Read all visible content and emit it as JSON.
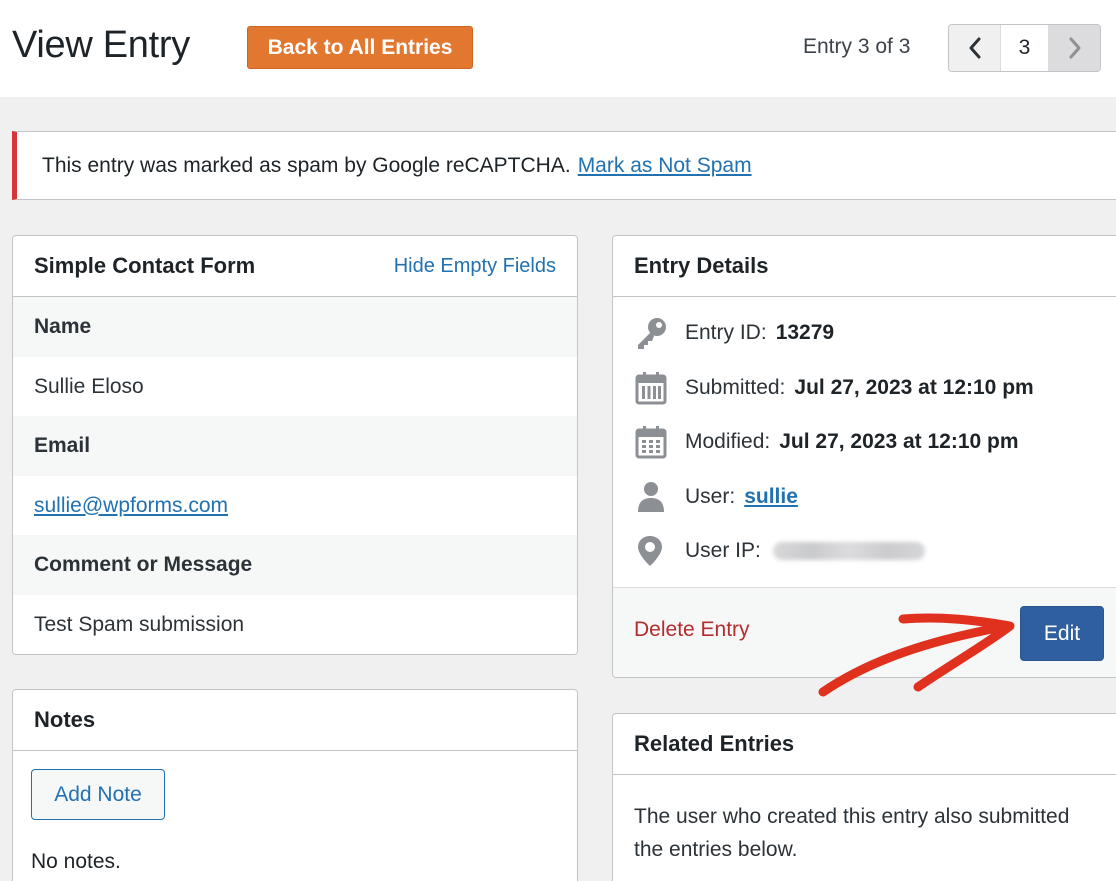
{
  "header": {
    "title": "View Entry",
    "back_button": "Back to All Entries",
    "entry_count": "Entry 3 of 3",
    "pager": {
      "current": "3"
    }
  },
  "notice": {
    "text": "This entry was marked as spam by Google reCAPTCHA.",
    "link": "Mark as Not Spam"
  },
  "form_box": {
    "title": "Simple Contact Form",
    "toggle_link": "Hide Empty Fields",
    "fields": [
      {
        "label": "Name",
        "value": "Sullie Eloso"
      },
      {
        "label": "Email",
        "value": "sullie@wpforms.com"
      },
      {
        "label": "Comment or Message",
        "value": "Test Spam submission"
      }
    ]
  },
  "notes_box": {
    "title": "Notes",
    "add_button": "Add Note",
    "empty_text": "No notes."
  },
  "details_box": {
    "title": "Entry Details",
    "rows": [
      {
        "icon": "key-icon",
        "label": "Entry ID:",
        "value": "13279"
      },
      {
        "icon": "calendar-icon",
        "label": "Submitted:",
        "value": "Jul 27, 2023 at 12:10 pm"
      },
      {
        "icon": "calendar-icon",
        "label": "Modified:",
        "value": "Jul 27, 2023 at 12:10 pm"
      },
      {
        "icon": "user-icon",
        "label": "User:",
        "value": "sullie"
      },
      {
        "icon": "location-pin-icon",
        "label": "User IP:",
        "value": ""
      }
    ],
    "delete_link": "Delete Entry",
    "edit_button": "Edit"
  },
  "related_box": {
    "title": "Related Entries",
    "text": "The user who created this entry also submitted the entries below."
  },
  "colors": {
    "accent_orange": "#e27730",
    "link_blue": "#2271b1",
    "edit_blue": "#2f5f9e",
    "spam_red": "#d63638",
    "delete_red": "#b32d2e",
    "annotation_arrow": "#e0301e"
  }
}
